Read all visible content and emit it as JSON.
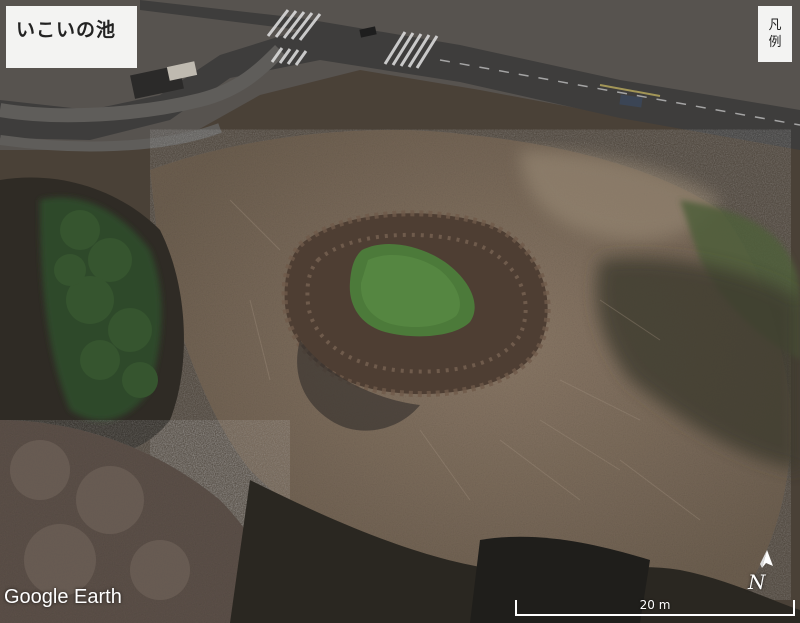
{
  "title": "いこいの池",
  "legend": {
    "chars": [
      "凡",
      "例"
    ]
  },
  "attribution": "Google Earth",
  "compass": {
    "letter": "N"
  },
  "scale": {
    "label": "20 m"
  }
}
